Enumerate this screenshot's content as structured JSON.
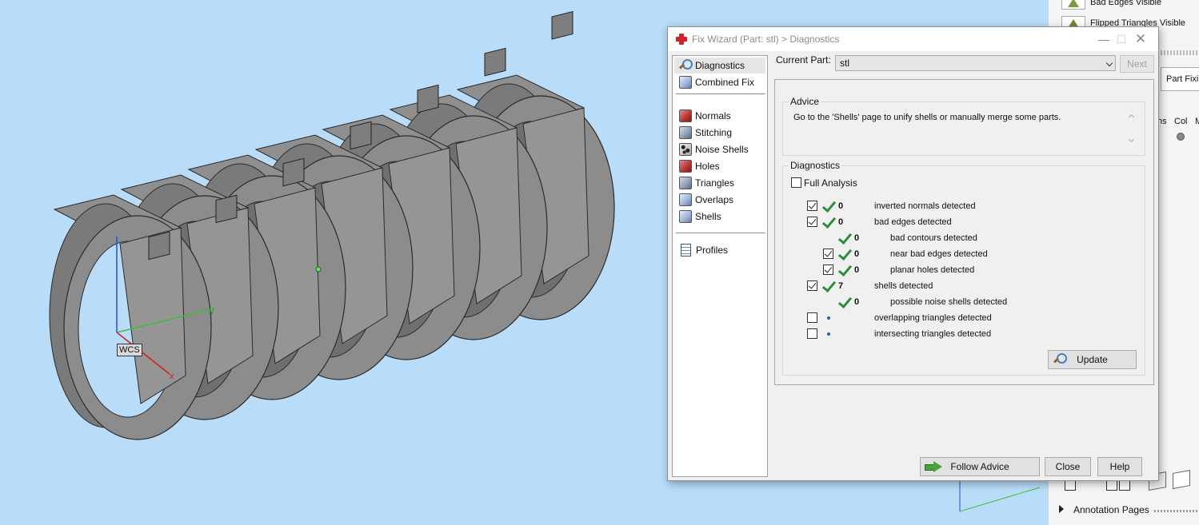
{
  "viewport": {
    "wcs_label": "WCS",
    "axis_x": "x",
    "axis_y": "y"
  },
  "side_panel": {
    "item1": "Bad Edges Visible",
    "item2": "Flipped Triangles Visible",
    "part_fixing": "Part Fixi",
    "col_ns": "ns",
    "col_col": "Col",
    "col_m": "M",
    "annotation_pages": "Annotation Pages"
  },
  "dialog": {
    "title": "Fix Wizard (Part: stl) > Diagnostics",
    "nav": {
      "diagnostics": "Diagnostics",
      "combined_fix": "Combined Fix",
      "normals": "Normals",
      "stitching": "Stitching",
      "noise_shells": "Noise Shells",
      "holes": "Holes",
      "triangles": "Triangles",
      "overlaps": "Overlaps",
      "shells": "Shells",
      "profiles": "Profiles"
    },
    "current_part_label": "Current Part:",
    "current_part_value": "stl",
    "next_label": "Next",
    "advice_title": "Advice",
    "advice_text": "Go to the 'Shells' page to unify shells or manually merge some parts.",
    "diagnostics_title": "Diagnostics",
    "full_analysis_label": "Full Analysis",
    "rows": [
      {
        "count": "0",
        "text": "inverted normals detected"
      },
      {
        "count": "0",
        "text": "bad edges detected"
      },
      {
        "count": "0",
        "text": "bad contours detected"
      },
      {
        "count": "0",
        "text": "near bad edges detected"
      },
      {
        "count": "0",
        "text": "planar holes detected"
      },
      {
        "count": "7",
        "text": "shells detected"
      },
      {
        "count": "0",
        "text": "possible noise shells detected"
      },
      {
        "count": "",
        "text": "overlapping triangles detected"
      },
      {
        "count": "",
        "text": "intersecting triangles detected"
      }
    ],
    "update_label": "Update",
    "follow_advice_label": "Follow Advice",
    "close_label": "Close",
    "help_label": "Help"
  }
}
